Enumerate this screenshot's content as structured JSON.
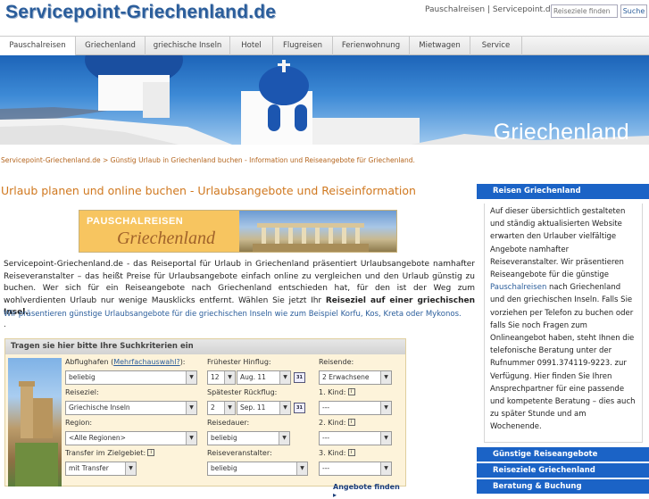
{
  "header": {
    "logo": "Servicepoint-Griechenland.de",
    "top_links": [
      "Pauschalreisen",
      "Servicepoint.de"
    ],
    "search_placeholder": "Reiseziele finden",
    "search_button": "Suche"
  },
  "nav": [
    "Pauschalreisen",
    "Griechenland",
    "griechische Inseln",
    "Hotel",
    "Flugreisen",
    "Ferienwohnung",
    "Mietwagen",
    "Service"
  ],
  "banner": {
    "title": "Griechenland"
  },
  "breadcrumb": "Servicepoint-Griechenland.de > Günstig Urlaub in Griechenland buchen - Information und Reiseangebote für Griechenland.",
  "main": {
    "heading": "Urlaub planen und online buchen - Urlaubsangebote und Reiseinformation",
    "promo": {
      "line1": "PAUSCHALREISEN",
      "line2": "Griechenland"
    },
    "intro_text": "Servicepoint-Griechenland.de - das Reiseportal für Urlaub in Griechenland präsentiert Urlaubsangebote namhafter Reiseveranstalter – das heißt Preise für Urlaubsangebote einfach online zu vergleichen und den Urlaub günstig zu buchen. Wer sich für ein Reiseangebote nach Griechenland entschieden hat, für den ist der Weg zum wohlverdienten Urlaub nur wenige Mausklicks entfernt. Wählen Sie jetzt Ihr",
    "intro_bold": "Reiseziel auf einer griechischen Insel.",
    "intro_line2": "Wir präsentieren günstige Urlaubsangebote für die griechischen Inseln wie zum Beispiel",
    "islands": "Korfu, Kos, Kreta oder  Mykonos.",
    "dot": "."
  },
  "search_form": {
    "title": "Tragen sie hier bitte Ihre Suchkriterien ein",
    "labels": {
      "airport": "Abflughafen (",
      "multi": "Mehrfachauswahl?",
      "airport_end": "):",
      "earliest": "Frühester Hinflug:",
      "travelers": "Reisende:",
      "destination": "Reiseziel:",
      "latest": "Spätester Rückflug:",
      "child1": "1. Kind:",
      "region": "Region:",
      "duration": "Reisedauer:",
      "child2": "2. Kind:",
      "transfer": "Transfer im Zielgebiet:",
      "operator": "Reiseveranstalter:",
      "child3": "3. Kind:"
    },
    "values": {
      "airport": "beliebig",
      "earliest_day": "12",
      "earliest_month": "Aug. 11",
      "travelers": "2 Erwachsene",
      "destination": "Griechische Inseln",
      "latest_day": "2",
      "latest_month": "Sep. 11",
      "child1": "---",
      "region": "<Alle Regionen>",
      "duration": "beliebig",
      "child2": "---",
      "transfer": "mit Transfer",
      "operator": "beliebig",
      "child3": "---"
    },
    "submit": "Angebote finden ▸"
  },
  "sidebar": {
    "heading": "Reisen Griechenland",
    "text_before": "Auf dieser übersichtlich gestalteten und ständig aktualisierten Website erwarten den Urlauber vielfältige Angebote namhafter Reiseveranstalter. Wir präsentieren Reiseangebote für die günstige",
    "text_link": "Pauschalreisen",
    "text_after": "nach Griechenland und den griechischen Inseln. Falls Sie vorziehen per Telefon zu buchen oder falls Sie noch Fragen zum Onlineangebot haben, steht Ihnen die telefonische Beratung unter der Rufnummer 0991.374119-9223. zur Verfügung. Hier finden Sie Ihren Ansprechpartner für eine passende und kompetente Beratung – dies auch zu später Stunde und am Wochenende.",
    "links": [
      "Günstige Reiseangebote",
      "Reiseziele Griechenland",
      "Beratung & Buchung"
    ]
  },
  "colors": {
    "brand_blue": "#1b63c6",
    "accent_orange": "#d0781f"
  }
}
